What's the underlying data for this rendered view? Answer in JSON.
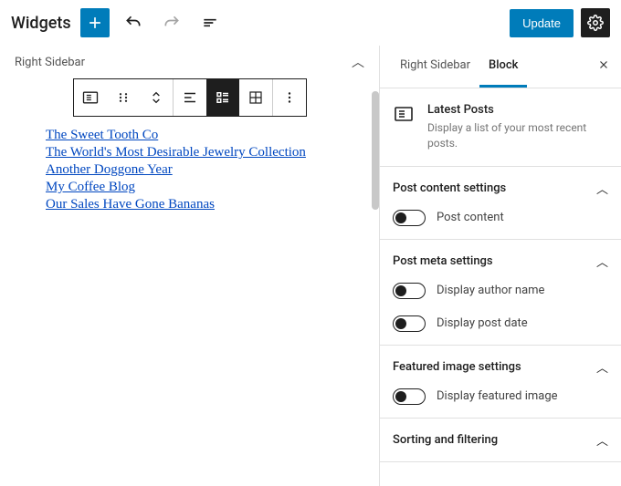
{
  "topbar": {
    "title": "Widgets",
    "update": "Update"
  },
  "editor": {
    "area_name": "Right Sidebar",
    "posts": [
      "The Sweet Tooth Co",
      "The World's Most Desirable Jewelry Collection",
      "Another Doggone Year",
      "My Coffee Blog",
      "Our Sales Have Gone Bananas"
    ]
  },
  "panel": {
    "tabs": {
      "area": "Right Sidebar",
      "block": "Block"
    },
    "block_info": {
      "title": "Latest Posts",
      "desc": "Display a list of your most recent posts."
    },
    "sections": {
      "content": {
        "title": "Post content settings",
        "toggles": [
          "Post content"
        ]
      },
      "meta": {
        "title": "Post meta settings",
        "toggles": [
          "Display author name",
          "Display post date"
        ]
      },
      "featured": {
        "title": "Featured image settings",
        "toggles": [
          "Display featured image"
        ]
      },
      "sorting": {
        "title": "Sorting and filtering"
      }
    }
  }
}
